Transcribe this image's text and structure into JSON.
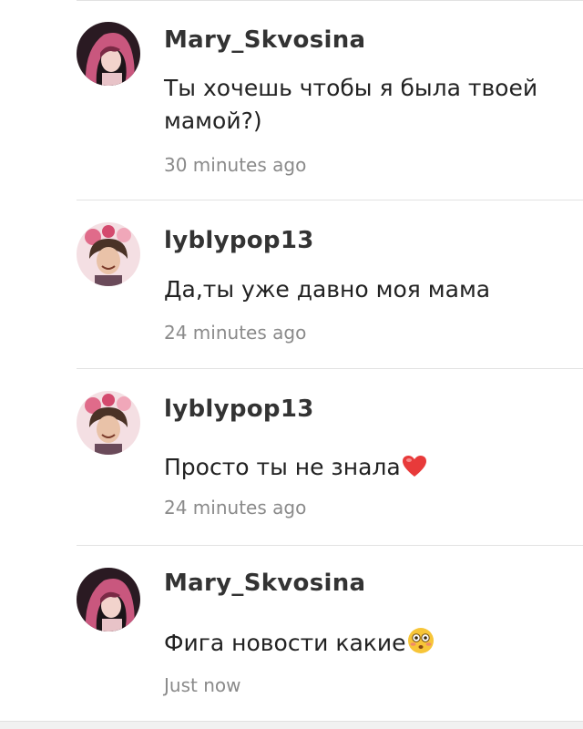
{
  "comments": [
    {
      "username": "Mary_Skvosina",
      "text": "Ты хочешь чтобы я была твоей мамой?)",
      "time": "30 minutes ago",
      "avatar": "avatar-girl-pink-hair",
      "emoji": ""
    },
    {
      "username": "lyblypop13",
      "text": "Да,ты уже давно моя мама",
      "time": "24 minutes ago",
      "avatar": "avatar-man-flower-crown",
      "emoji": ""
    },
    {
      "username": "lyblypop13",
      "text": "Просто ты не знала",
      "time": "24 minutes ago",
      "avatar": "avatar-man-flower-crown",
      "emoji": "red-heart-emoji"
    },
    {
      "username": "Mary_Skvosina",
      "text": "Фига новости какие",
      "time": "Just now",
      "avatar": "avatar-girl-pink-hair",
      "emoji": "flushed-face-emoji"
    }
  ],
  "colors": {
    "username": "#333333",
    "text": "#222222",
    "time": "#8a8a8a",
    "divider": "#e2e2e2"
  }
}
